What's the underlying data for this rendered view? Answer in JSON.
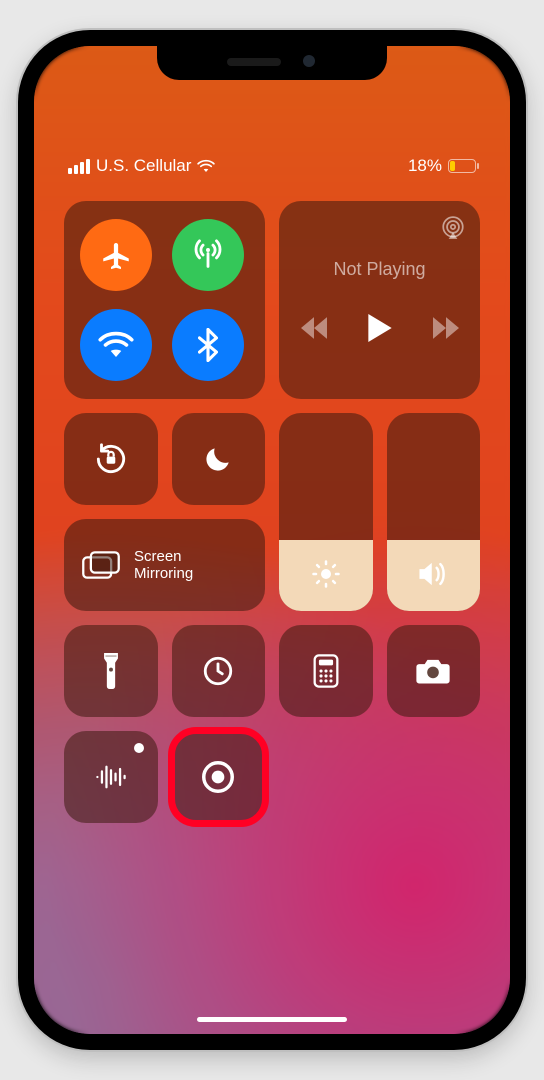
{
  "status": {
    "carrier": "U.S. Cellular",
    "battery_percent": "18%",
    "battery_fill_pct": 18
  },
  "music": {
    "now_playing_label": "Not Playing"
  },
  "mirror": {
    "line1": "Screen",
    "line2": "Mirroring"
  },
  "sliders": {
    "brightness_pct": 36,
    "volume_pct": 36
  },
  "connectivity": {
    "airplane_on": true,
    "cellular_on": true,
    "wifi_on": true,
    "bluetooth_on": true
  },
  "icons": {
    "airplane": "airplane-icon",
    "cellular": "cellular-antenna-icon",
    "wifi": "wifi-icon",
    "bluetooth": "bluetooth-icon",
    "airplay": "airplay-icon",
    "prev": "previous-track-icon",
    "play": "play-icon",
    "next": "next-track-icon",
    "lock_rotation": "rotation-lock-icon",
    "dnd": "do-not-disturb-moon-icon",
    "screen_mirror": "screen-mirroring-icon",
    "brightness": "brightness-sun-icon",
    "volume": "speaker-volume-icon",
    "flashlight": "flashlight-icon",
    "timer": "timer-icon",
    "calculator": "calculator-icon",
    "camera": "camera-icon",
    "voice_memo": "voice-memo-icon",
    "screen_record": "screen-record-icon"
  }
}
